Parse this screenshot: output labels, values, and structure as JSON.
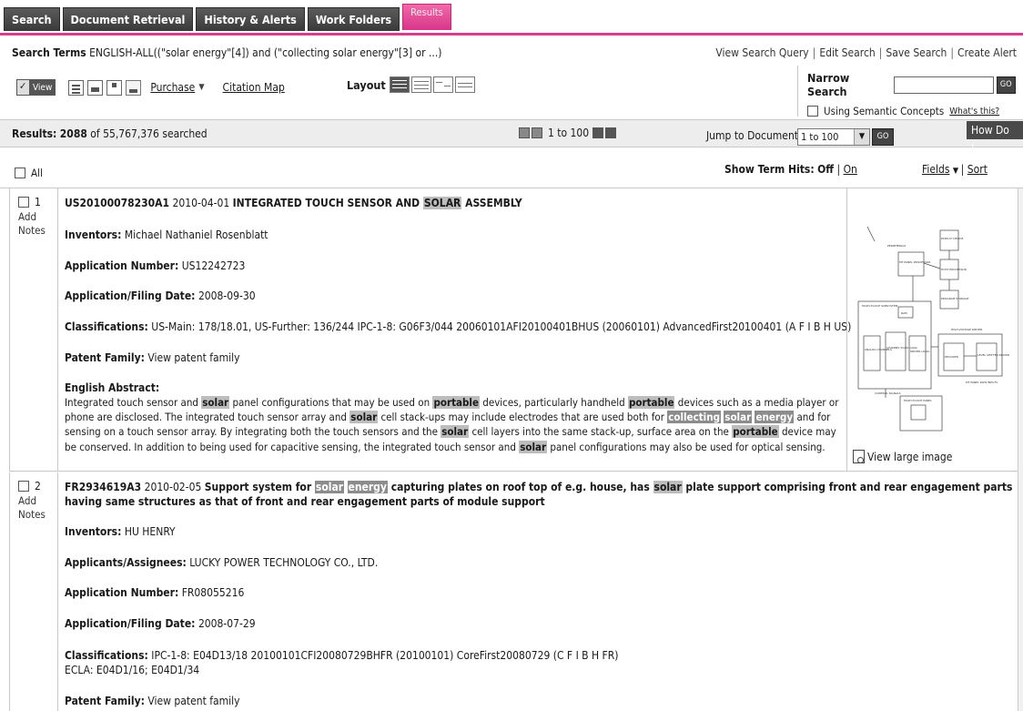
{
  "tabs": [
    {
      "label": "Search",
      "active": false
    },
    {
      "label": "Document Retrieval",
      "active": false
    },
    {
      "label": "History & Alerts",
      "active": false
    },
    {
      "label": "Work Folders",
      "active": false
    },
    {
      "label": "Results",
      "active": true
    }
  ],
  "header": {
    "search_terms_label": "Search Terms",
    "search_terms_value": "ENGLISH-ALL((\"solar energy\"[4]) and (\"collecting solar energy\"[3] or ...)",
    "links": [
      "View Search Query",
      "Edit Search",
      "Save Search",
      "Create Alert"
    ]
  },
  "toolbar": {
    "view_label": "View",
    "purchase_label": "Purchase",
    "citation_label": "Citation Map",
    "layout_label": "Layout"
  },
  "narrow": {
    "label": "Narrow Search",
    "go_label": "GO",
    "semantic_label": "Using Semantic Concepts",
    "whats_this": "What's this?"
  },
  "results_bar": {
    "count": "2088",
    "searched": "of 55,767,376 searched",
    "label": "Results:",
    "pager_text": "1 to 100",
    "jump_label": "Jump to Documents",
    "jump_value": "1 to 100",
    "go_label": "GO",
    "help_label": "How Do I..."
  },
  "list_controls": {
    "all_label": "All",
    "show_term_hits": "Show Term Hits:",
    "off_label": "Off",
    "on_label": "On",
    "fields_label": "Fields",
    "sort_label": "Sort"
  },
  "records": [
    {
      "number": "1",
      "notes": "Add Notes",
      "id": "US20100078230A1",
      "date": "2010-04-01",
      "title_pre": "INTEGRATED TOUCH SENSOR AND ",
      "title_hl": "SOLAR",
      "title_post": " ASSEMBLY",
      "inventors_label": "Inventors:",
      "inventors": "Michael Nathaniel Rosenblatt",
      "appnum_label": "Application Number:",
      "appnum": "US12242723",
      "filing_label": "Application/Filing Date:",
      "filing": "2008-09-30",
      "class_label": "Classifications:",
      "class": "US-Main: 178/18.01, US-Further: 136/244 IPC-1-8: G06F3/044 20060101AFI20100401BHUS (20060101) AdvancedFirst20100401 (A F I B H US)",
      "family_label": "Patent Family:",
      "family": "View patent family",
      "abstract_label": "English Abstract:",
      "abstract": {
        "p1": "Integrated touch sensor and ",
        "w1": "solar",
        "p2": " panel configurations that may be used on ",
        "w2": "portable",
        "p3": " devices, particularly handheld ",
        "w3": "portable",
        "p4": " devices such as a media player or phone are disclosed. The integrated touch sensor array and ",
        "w4": "solar",
        "p5": " cell stack-ups may include electrodes that are used both for ",
        "w5": "collecting",
        "w6": "solar",
        "w7": "energy",
        "p6": " and for sensing on a touch sensor array. By integrating both the touch sensors and the ",
        "w8": "solar",
        "p7": " cell layers into the same stack-up, surface area on the ",
        "w9": "portable",
        "p8": " device may be conserved. In addition to being used for capacitive sensing, the integrated touch sensor and ",
        "w10": "solar",
        "p9": " panel configurations may also be used for optical sensing."
      },
      "view_large": "View large image",
      "diagram": {
        "peripherals": "PERIPHERALS",
        "display": "DISPLAY DEVICE",
        "mt_panel": "MT PANEL PROCESSOR",
        "host": "HOST PROCESSOR",
        "program": "PROGRAM STORAGE",
        "ram": "RAM",
        "subsystem": "MULTI-TOUCH SUBSYSTEM",
        "analog": "ANALOG CHANNELS",
        "channel": "CHANNEL SCAN LOGIC",
        "driver": "DRIVER LOGIC",
        "hv_driver": "HIGH-VOLTAGE DRIVER",
        "decoder": "DECODER",
        "level": "LEVEL SHIFTER DRIVER",
        "control": "CONTROL SIGNALS",
        "mt_row": "MT PANEL ROW INPUTS",
        "mt_panel2": "MULTI-TOUCH PANEL"
      }
    },
    {
      "number": "2",
      "notes": "Add Notes",
      "id": "FR2934619A3",
      "date": "2010-02-05",
      "title_pre": "Support system for ",
      "title_hl1": "solar",
      "title_hl2": "energy",
      "title_mid": " capturing plates on roof top of e.g. house, has ",
      "title_hl3": "solar",
      "title_post": " plate support comprising front and rear engagement parts having same structures as that of front and rear engagement parts of module support",
      "inventors_label": "Inventors:",
      "inventors": "HU HENRY",
      "assignee_label": "Applicants/Assignees:",
      "assignee": "LUCKY POWER TECHNOLOGY CO., LTD.",
      "appnum_label": "Application Number:",
      "appnum": "FR08055216",
      "filing_label": "Application/Filing Date:",
      "filing": "2008-07-29",
      "class_label": "Classifications:",
      "class": "IPC-1-8: E04D13/18 20100101CFI20080729BHFR (20100101) CoreFirst20080729 (C F I B H FR)",
      "ecla": "ECLA: E04D1/16; E04D1/34",
      "family_label": "Patent Family:",
      "family": "View patent family"
    }
  ]
}
